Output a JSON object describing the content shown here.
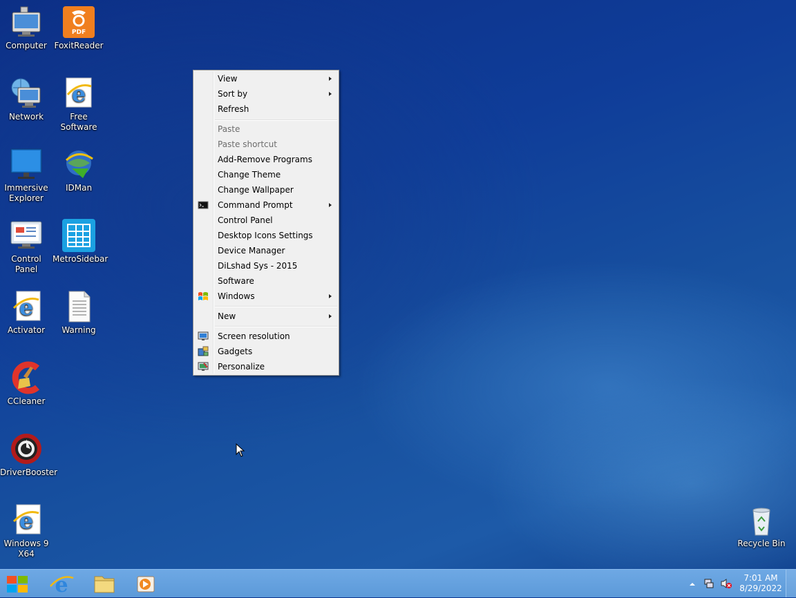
{
  "desktop_icons": [
    {
      "name": "Computer"
    },
    {
      "name": "FoxitReader",
      "badge": "PDF"
    },
    {
      "name": "Network"
    },
    {
      "name": "Free Software"
    },
    {
      "name": "Immersive Explorer"
    },
    {
      "name": "IDMan"
    },
    {
      "name": "Control Panel"
    },
    {
      "name": "MetroSidebar"
    },
    {
      "name": "Activator"
    },
    {
      "name": "Warning"
    },
    {
      "name": "CCleaner"
    },
    {
      "name": "DriverBooster"
    },
    {
      "name": "Windows 9 X64"
    },
    {
      "name": "Recycle Bin"
    }
  ],
  "context_menu": {
    "items": [
      {
        "label": "View",
        "submenu": true
      },
      {
        "label": "Sort by",
        "submenu": true
      },
      {
        "label": "Refresh"
      },
      {
        "label": "Paste",
        "disabled": true
      },
      {
        "label": "Paste shortcut",
        "disabled": true
      },
      {
        "label": "Add-Remove Programs"
      },
      {
        "label": "Change Theme"
      },
      {
        "label": "Change Wallpaper"
      },
      {
        "label": "Command Prompt",
        "submenu": true,
        "icon": "cmd-icon"
      },
      {
        "label": "Control Panel"
      },
      {
        "label": "Desktop Icons Settings"
      },
      {
        "label": "Device Manager"
      },
      {
        "label": "DiLshad Sys - 2015"
      },
      {
        "label": "Software"
      },
      {
        "label": "Windows",
        "submenu": true,
        "icon": "windows-flag-icon"
      },
      {
        "label": "New",
        "submenu": true
      },
      {
        "label": "Screen resolution",
        "icon": "screen-resolution-icon"
      },
      {
        "label": "Gadgets",
        "icon": "gadgets-icon"
      },
      {
        "label": "Personalize",
        "icon": "personalize-icon"
      }
    ]
  },
  "taskbar": {
    "pinned": [
      "start-button",
      "internet-explorer-icon",
      "file-explorer-icon",
      "media-player-icon"
    ],
    "clock": {
      "time": "7:01 AM",
      "date": "8/29/2022"
    }
  }
}
